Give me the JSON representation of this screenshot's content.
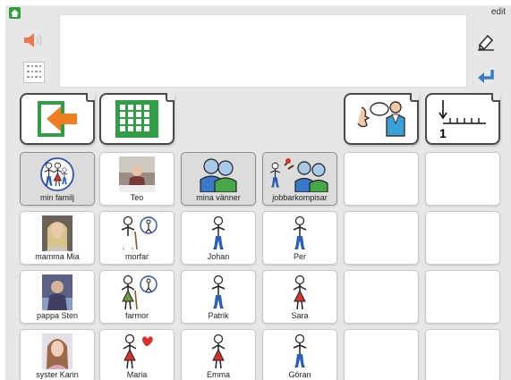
{
  "header": {
    "edit_label": "edit"
  },
  "message_area": {
    "text": ""
  },
  "tabs": [
    {
      "name": "back",
      "icon": "back-arrow-icon"
    },
    {
      "name": "grid",
      "icon": "grid-icon"
    },
    {
      "name": "speak",
      "icon": "talking-person-icon"
    },
    {
      "name": "number-line",
      "icon": "number-line-icon"
    }
  ],
  "grid": {
    "rows": [
      [
        {
          "label": "min familj",
          "icon": "family-icon",
          "folder": true
        },
        {
          "label": "Teo",
          "icon": "photo-child",
          "folder": false
        },
        {
          "label": "mina vänner",
          "icon": "friends-icon",
          "folder": true
        },
        {
          "label": "jobbarkompisar",
          "icon": "coworkers-icon",
          "folder": true
        },
        {
          "label": "",
          "icon": "",
          "folder": false
        },
        {
          "label": "",
          "icon": "",
          "folder": false
        }
      ],
      [
        {
          "label": "mamma Mia",
          "icon": "photo-woman",
          "folder": false
        },
        {
          "label": "morfar",
          "icon": "grandfather-icon",
          "folder": false
        },
        {
          "label": "Johan",
          "icon": "man-icon",
          "folder": false
        },
        {
          "label": "Per",
          "icon": "man-icon",
          "folder": false
        },
        {
          "label": "",
          "icon": "",
          "folder": false
        },
        {
          "label": "",
          "icon": "",
          "folder": false
        }
      ],
      [
        {
          "label": "pappa Sten",
          "icon": "photo-man",
          "folder": false
        },
        {
          "label": "farmor",
          "icon": "grandmother-icon",
          "folder": false
        },
        {
          "label": "Patrik",
          "icon": "man-icon",
          "folder": false
        },
        {
          "label": "Sara",
          "icon": "woman-icon",
          "folder": false
        },
        {
          "label": "",
          "icon": "",
          "folder": false
        },
        {
          "label": "",
          "icon": "",
          "folder": false
        }
      ],
      [
        {
          "label": "syster Karin",
          "icon": "photo-girl",
          "folder": false
        },
        {
          "label": "Maria",
          "icon": "woman-heart-icon",
          "folder": false
        },
        {
          "label": "Emma",
          "icon": "woman-icon",
          "folder": false
        },
        {
          "label": "Göran",
          "icon": "man-icon",
          "folder": false
        },
        {
          "label": "",
          "icon": "",
          "folder": false
        },
        {
          "label": "",
          "icon": "",
          "folder": false
        }
      ]
    ]
  }
}
